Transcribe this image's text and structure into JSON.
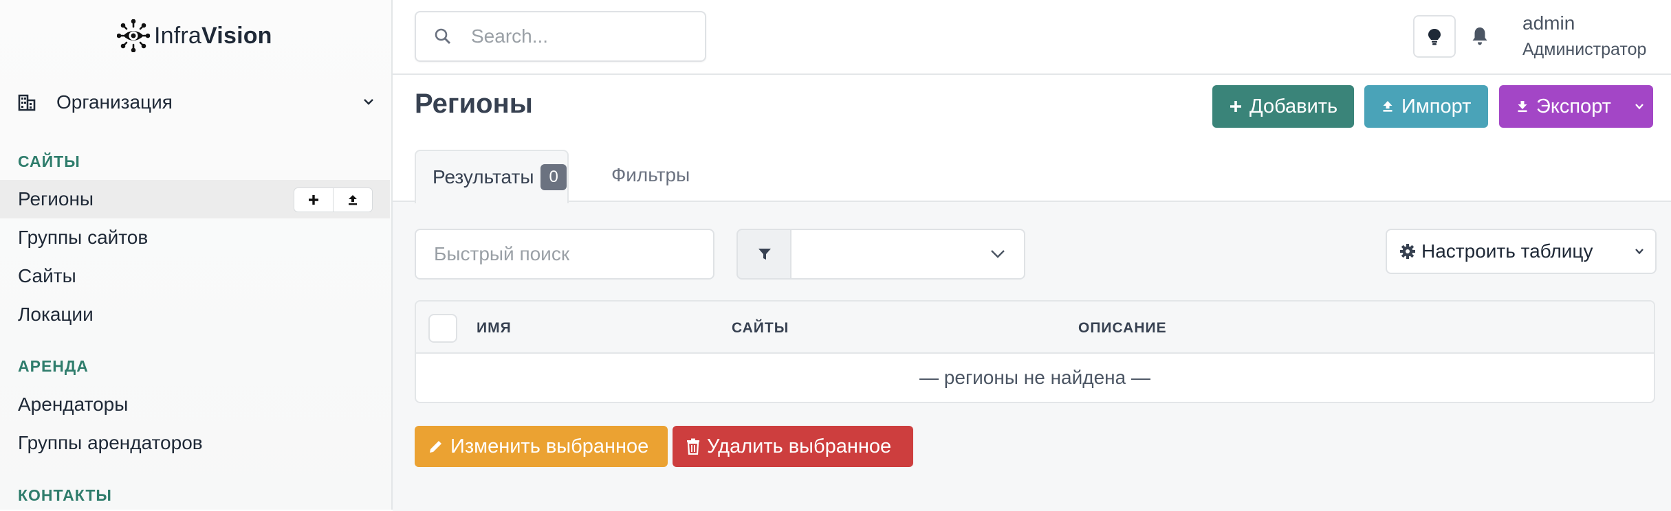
{
  "app": {
    "brand_light": "Infra",
    "brand_bold": "Vision"
  },
  "sidebar": {
    "org_label": "Организация",
    "sections": [
      {
        "title": "САЙТЫ",
        "items": [
          "Регионы",
          "Группы сайтов",
          "Сайты",
          "Локации"
        ]
      },
      {
        "title": "АРЕНДА",
        "items": [
          "Арендаторы",
          "Группы арендаторов"
        ]
      },
      {
        "title": "КОНТАКТЫ",
        "items": []
      }
    ],
    "active_item": "Регионы",
    "active_actions": [
      "add-icon",
      "upload-icon"
    ]
  },
  "topbar": {
    "search_placeholder": "Search...",
    "user_name": "admin",
    "user_role": "Администратор"
  },
  "page": {
    "title": "Регионы",
    "buttons": {
      "add": "Добавить",
      "import": "Импорт",
      "export": "Экспорт"
    },
    "tabs": {
      "results": "Результаты",
      "results_count": "0",
      "filters": "Фильтры"
    },
    "quick_search_placeholder": "Быстрый поиск",
    "filter_select_value": "",
    "configure_table": "Настроить таблицу",
    "table": {
      "columns": [
        "ИМЯ",
        "САЙТЫ",
        "ОПИСАНИЕ"
      ],
      "rows": [],
      "empty_text": "— регионы не найдена —"
    },
    "bulk": {
      "edit": "Изменить выбранное",
      "delete": "Удалить выбранное"
    }
  },
  "colors": {
    "accent": "#2f7d6c",
    "add": "#3a8479",
    "import": "#4aa3b8",
    "export": "#a346c6",
    "edit": "#eba232",
    "delete": "#cd3e3e"
  }
}
